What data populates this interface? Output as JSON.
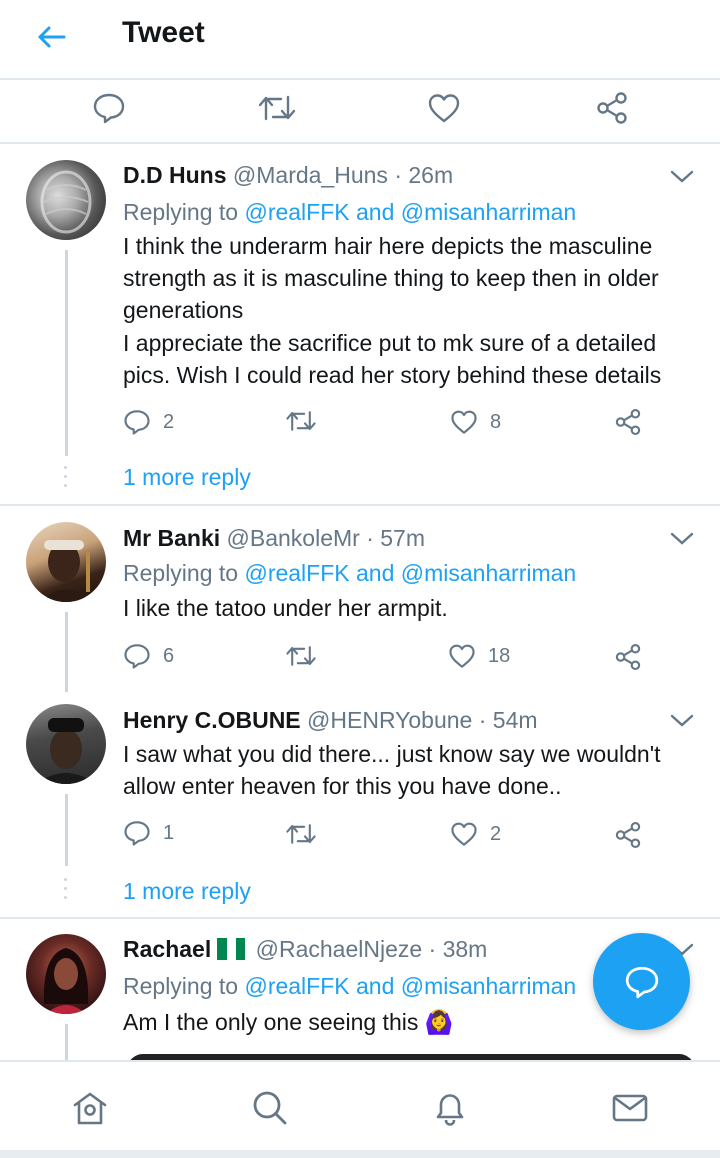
{
  "header": {
    "title": "Tweet"
  },
  "colors": {
    "accent": "#1da1f2",
    "muted": "#657786",
    "text": "#14171a",
    "divider": "#e1e8ed"
  },
  "main_actions": [
    "reply-icon",
    "retweet-icon",
    "like-icon",
    "share-icon"
  ],
  "replies": [
    {
      "name": "D.D Huns",
      "handle": "@Marda_Huns",
      "time": "· 26m",
      "replying_prefix": "Replying to",
      "replying_to": "@realFFK and @misanharriman",
      "text": "I think the underarm hair here depicts the masculine strength as it is masculine thing to keep then in older generations\nI appreciate the sacrifice put to mk sure of a detailed pics. Wish I could read her story behind these details",
      "replies": "2",
      "retweets": "",
      "likes": "8",
      "more": "1 more reply"
    },
    {
      "name": "Mr Banki",
      "handle": "@BankoleMr",
      "time": "· 57m",
      "replying_prefix": "Replying to",
      "replying_to": "@realFFK and @misanharriman",
      "text": "I like the tatoo under her armpit.",
      "replies": "6",
      "retweets": "",
      "likes": "18"
    },
    {
      "name": "Henry C.OBUNE",
      "handle": "@HENRYobune",
      "time": "· 54m",
      "text": "I saw what you did there... just know say we wouldn't allow enter heaven for this you have done..",
      "replies": "1",
      "retweets": "",
      "likes": "2",
      "more": "1 more reply"
    },
    {
      "name": "Rachael",
      "handle": "@RachaelNjeze",
      "time": "· 38m",
      "replying_prefix": "Replying to",
      "replying_to": "@realFFK and @misanharriman",
      "text": "Am I the only one seeing this 🙆‍♀️"
    }
  ],
  "bottom_nav": [
    "home-icon",
    "search-icon",
    "notifications-icon",
    "messages-icon"
  ]
}
